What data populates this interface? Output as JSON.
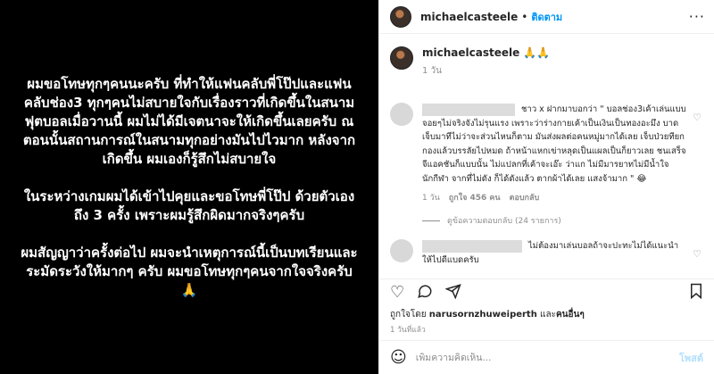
{
  "post_image": {
    "paragraphs": [
      "ผมขอโทษทุกๆคนนะครับ ที่ทำให้แฟนคลับพี่โป๊ปและแฟนคลับช่อง3 ทุกๆคนไม่สบายใจกับเรื่องราวที่เกิดขึ้นในสนามฟุตบอลเมื่อวานนี้ ผมไม่ได้มีเจตนาจะให้เกิดขึ้นเลยครับ ณ ตอนนั้นสถานการณ์ในสนามทุกอย่างมันไปไวมาก หลังจากเกิดขึ้น ผมเองก็รู้สึกไม่สบายใจ",
      "ในระหว่างเกมผมได้เข้าไปคุยและขอโทษพี่โป๊ป ด้วยตัวเอง ถึง 3 ครั้ง เพราะผมรู้สึกผิดมากจริงๆครับ",
      "ผมสัญญาว่าครั้งต่อไป ผมจะนำเหตุการณ์นี้เป็นบทเรียนและระมัดระวังให้มากๆ ครับ ผมขอโทษทุกๆคนจากใจจริงครับ 🙏"
    ]
  },
  "header": {
    "username": "michaelcasteele",
    "separator": "•",
    "follow_label": "ติดตาม",
    "more_label": "···"
  },
  "caption": {
    "username": "michaelcasteele",
    "text": "🙏🙏",
    "time": "1 วัน"
  },
  "comments": [
    {
      "text": "ชาว x ฝากมาบอกว่า \" บอลช่อง3เค้าเล่นแบบจอยๆไม่จริงจังไม่รุนแรง เพราะว่าร่างกายเค้าเป็นเงินเป็นทองอะมึง บาดเจ็บมาทีไม่ว่าจะส่วนไหนก็ตาม มันส่งผลต่อคนหมู่มากได้เลย เจ็บป่วยทียกกองแล้วบรรลัยไปหมด ถ้าหน้าแหกเข่าหลุดเป็นแผลเป็นก็ยาวเลย ชนเสร็จจีแอคชันก็แบบนั้น ไม่แปลกที่เค้าจะเอ๊ะ ว่าแก ไม่มีมารยาทไม่มีน้ำใจนักกีฬา จากที่ไม่ดัง ก็ได้ดังแล้ว ตากผ้าได้เลย แสงจ้ามาก \" 😂",
      "time": "1 วัน",
      "likes": "ถูกใจ 456 คน",
      "reply_label": "ตอบกลับ",
      "view_replies": "ดูข้อความตอบกลับ (24 รายการ)"
    },
    {
      "text": "ไม่ต้องมาเล่นบอลถ้าจะปะทะไม่ได้แนะนำให้ไปดีแบดครับ"
    }
  ],
  "actions": {
    "like_icon": "heart-icon",
    "comment_icon": "comment-icon",
    "share_icon": "share-icon",
    "save_icon": "bookmark-icon"
  },
  "likes_line": {
    "prefix": "ถูกใจโดย ",
    "user": "narusornzhuweiperth",
    "middle": " และ",
    "others": "คนอื่นๆ"
  },
  "posted_ago": "1 วันที่แล้ว",
  "add_comment": {
    "placeholder": "เพิ่มความคิดเห็น...",
    "post_label": "โพสต์"
  }
}
